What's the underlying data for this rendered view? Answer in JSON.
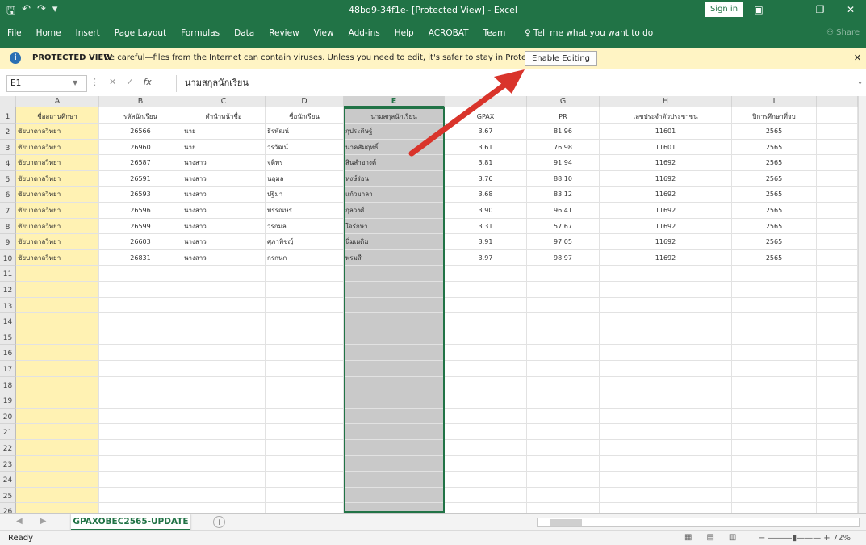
{
  "window": {
    "title": "48bd9-34f1e- [Protected View] - Excel",
    "signin_label": "Sign in"
  },
  "ribbon": {
    "tabs": [
      "File",
      "Home",
      "Insert",
      "Page Layout",
      "Formulas",
      "Data",
      "Review",
      "View",
      "Add-ins",
      "Help",
      "ACROBAT",
      "Team"
    ],
    "tell_me": "Tell me what you want to do",
    "share": "Share"
  },
  "protected": {
    "title": "PROTECTED VIEW",
    "message": "Be careful—files from the Internet can contain viruses. Unless you need to edit, it's safer to stay in Protected View.",
    "enable_label": "Enable Editing"
  },
  "formula": {
    "name_box": "E1",
    "value": "นามสกุลนักเรียน"
  },
  "sheet": {
    "columns": [
      "A",
      "B",
      "C",
      "D",
      "E",
      "F",
      "G",
      "H",
      "I"
    ],
    "selected_column": "E",
    "headers": [
      "ชื่อสถานศึกษา",
      "รหัสนักเรียน",
      "คำนำหน้าชื่อ",
      "ชื่อนักเรียน",
      "นามสกุลนักเรียน",
      "GPAX",
      "PR",
      "เลขประจำตัวประชาชน",
      "ปีการศึกษาที่จบ"
    ],
    "rows": [
      [
        "ชัยบาดาลวิทยา",
        "26566",
        "นาย",
        "ธีรพัฒน์",
        "กุประดิษฐ์",
        "3.67",
        "81.96",
        "11601",
        "2565"
      ],
      [
        "ชัยบาดาลวิทยา",
        "26960",
        "นาย",
        "วรวัฒน์",
        "นาคสัมฤทธิ์",
        "3.61",
        "76.98",
        "11601",
        "2565"
      ],
      [
        "ชัยบาดาลวิทยา",
        "26587",
        "นางสาว",
        "จุติพร",
        "สินสำอางค์",
        "3.81",
        "91.94",
        "11692",
        "2565"
      ],
      [
        "ชัยบาดาลวิทยา",
        "26591",
        "นางสาว",
        "นฤมล",
        "หงษ์ร่อน",
        "3.76",
        "88.10",
        "11692",
        "2565"
      ],
      [
        "ชัยบาดาลวิทยา",
        "26593",
        "นางสาว",
        "ปฐิมา",
        "แก้วมาลา",
        "3.68",
        "83.12",
        "11692",
        "2565"
      ],
      [
        "ชัยบาดาลวิทยา",
        "26596",
        "นางสาว",
        "พรรณษร",
        "กุลวงศ์",
        "3.90",
        "96.41",
        "11692",
        "2565"
      ],
      [
        "ชัยบาดาลวิทยา",
        "26599",
        "นางสาว",
        "วรกมล",
        "ใจรักษา",
        "3.31",
        "57.67",
        "11692",
        "2565"
      ],
      [
        "ชัยบาดาลวิทยา",
        "26603",
        "นางสาว",
        "ศุภาพิชญ์",
        "นิ่มเผดิม",
        "3.91",
        "97.05",
        "11692",
        "2565"
      ],
      [
        "ชัยบาดาลวิทยา",
        "26831",
        "นางสาว",
        "กรกนก",
        "พรมสี",
        "3.97",
        "98.97",
        "11692",
        "2565"
      ]
    ],
    "row_numbers": [
      "1",
      "2",
      "3",
      "4",
      "5",
      "6",
      "7",
      "8",
      "9",
      "10",
      "11",
      "12",
      "13",
      "14",
      "15",
      "16",
      "17",
      "18",
      "19",
      "20",
      "21",
      "22",
      "23",
      "24",
      "25",
      "26"
    ],
    "tab_name": "GPAXOBEC2565-UPDATE"
  },
  "status": {
    "ready": "Ready",
    "zoom": "72%"
  },
  "colors": {
    "excel_green": "#217346",
    "arrow_red": "#d9342b",
    "col_a_fill": "#fff2b3",
    "col_e_fill": "#c9c9c9"
  }
}
